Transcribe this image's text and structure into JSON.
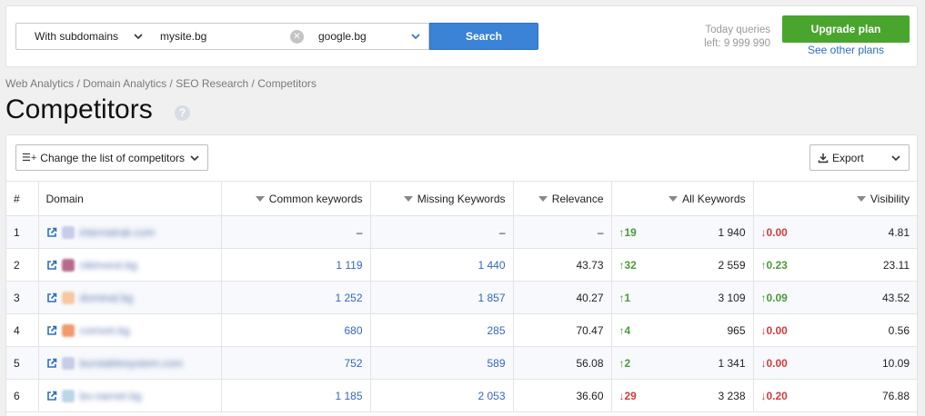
{
  "search": {
    "subdomain_select": "With subdomains",
    "domain_value": "mysite.bg",
    "engine_value": "google.bg",
    "button_label": "Search"
  },
  "queries": {
    "line1": "Today queries",
    "line2": "left: 9 999 990"
  },
  "plan": {
    "upgrade_label": "Upgrade plan",
    "other_plans_label": "See other plans"
  },
  "breadcrumb": "Web Analytics / Domain Analytics / SEO Research / Competitors",
  "page_title": "Competitors",
  "help_glyph": "?",
  "toolbar": {
    "change_list_label": "Change the list of competitors",
    "change_list_glyph": "☰+",
    "export_label": "Export"
  },
  "table": {
    "headers": {
      "index": "#",
      "domain": "Domain",
      "common": "Common keywords",
      "missing": "Missing Keywords",
      "relevance": "Relevance",
      "all_keywords": "All Keywords",
      "visibility": "Visibility"
    },
    "rows": [
      {
        "index": "1",
        "domain": "internatrak.com",
        "favicon_color": "#c7cde8",
        "common": "–",
        "missing": "–",
        "relevance": "–",
        "kw_change": "19",
        "kw_dir": "up",
        "kw_total": "1 940",
        "vis_change": "0.00",
        "vis_dir": "down",
        "visibility": "4.81"
      },
      {
        "index": "2",
        "domain": "nikinvest.bg",
        "favicon_color": "#b86a8a",
        "common": "1 119",
        "missing": "1 440",
        "relevance": "43.73",
        "kw_change": "32",
        "kw_dir": "up",
        "kw_total": "2 559",
        "vis_change": "0.23",
        "vis_dir": "up",
        "visibility": "23.11"
      },
      {
        "index": "3",
        "domain": "dominal.bg",
        "favicon_color": "#f5c8a0",
        "common": "1 252",
        "missing": "1 857",
        "relevance": "40.27",
        "kw_change": "1",
        "kw_dir": "up",
        "kw_total": "3 109",
        "vis_change": "0.09",
        "vis_dir": "up",
        "visibility": "43.52"
      },
      {
        "index": "4",
        "domain": "comvet.bg",
        "favicon_color": "#f09a70",
        "common": "680",
        "missing": "285",
        "relevance": "70.47",
        "kw_change": "4",
        "kw_dir": "up",
        "kw_total": "965",
        "vis_change": "0.00",
        "vis_dir": "down",
        "visibility": "0.56"
      },
      {
        "index": "5",
        "domain": "burstablesystem.com",
        "favicon_color": "#c7cde8",
        "common": "752",
        "missing": "589",
        "relevance": "56.08",
        "kw_change": "2",
        "kw_dir": "up",
        "kw_total": "1 341",
        "vis_change": "0.00",
        "vis_dir": "down",
        "visibility": "10.09"
      },
      {
        "index": "6",
        "domain": "bo-narnet.bg",
        "favicon_color": "#bcd6e6",
        "common": "1 185",
        "missing": "2 053",
        "relevance": "36.60",
        "kw_change": "29",
        "kw_dir": "down",
        "kw_total": "3 238",
        "vis_change": "0.20",
        "vis_dir": "down",
        "visibility": "76.88"
      }
    ]
  },
  "colors": {
    "primary": "#3a83d6",
    "upgrade": "#4aa52e",
    "up": "#4d9a3a",
    "down": "#cf3d3d",
    "link": "#3567b8"
  },
  "icons": [
    "chevron-down-icon",
    "clear-icon",
    "help-icon",
    "list-add-icon",
    "download-icon",
    "external-link-icon",
    "arrow-up-icon",
    "arrow-down-icon",
    "favicon"
  ]
}
